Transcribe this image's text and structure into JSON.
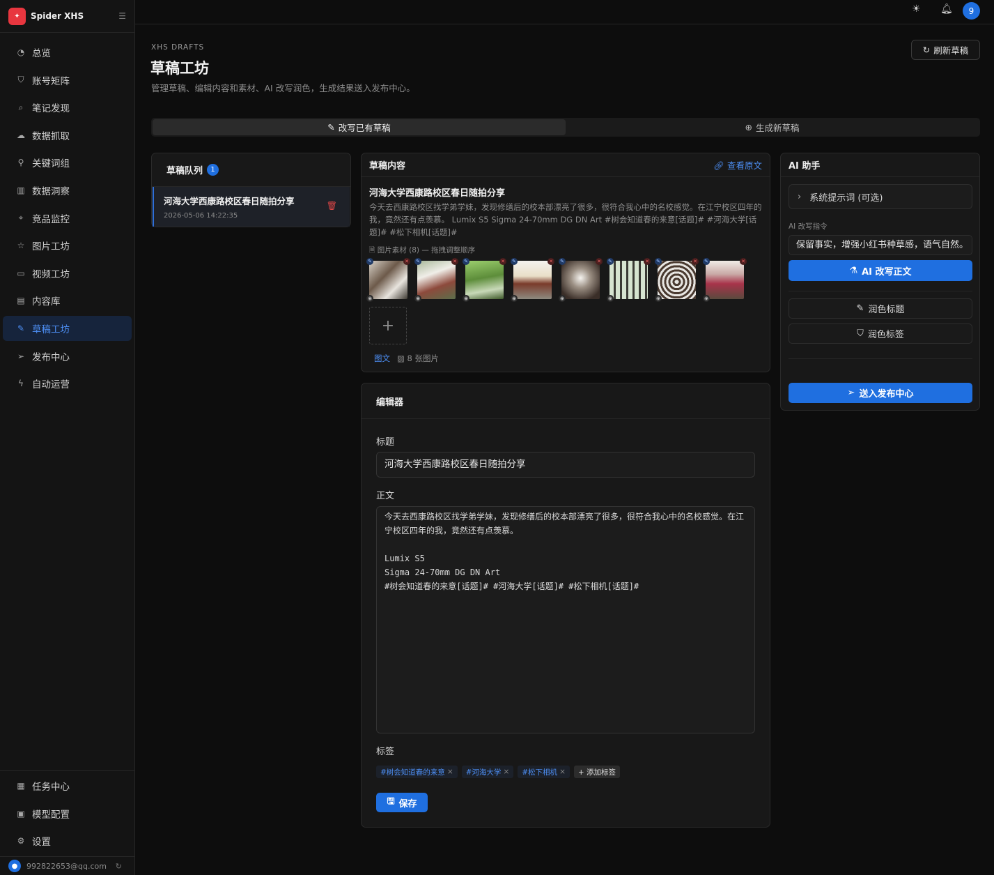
{
  "app": {
    "name": "Spider XHS"
  },
  "nav": {
    "items": [
      {
        "label": "总览",
        "icon": "gauge-icon"
      },
      {
        "label": "账号矩阵",
        "icon": "shield-icon"
      },
      {
        "label": "笔记发现",
        "icon": "search-icon"
      },
      {
        "label": "数据抓取",
        "icon": "cloud-download-icon"
      },
      {
        "label": "关键词组",
        "icon": "key-search-icon"
      },
      {
        "label": "数据洞察",
        "icon": "bar-chart-icon"
      },
      {
        "label": "竞品监控",
        "icon": "crosshair-icon"
      },
      {
        "label": "图片工坊",
        "icon": "star-icon"
      },
      {
        "label": "视频工坊",
        "icon": "video-icon"
      },
      {
        "label": "内容库",
        "icon": "database-icon"
      },
      {
        "label": "草稿工坊",
        "icon": "edit-icon",
        "active": true
      },
      {
        "label": "发布中心",
        "icon": "send-icon"
      },
      {
        "label": "自动运营",
        "icon": "bolt-icon"
      }
    ],
    "bottom": [
      {
        "label": "任务中心",
        "icon": "calendar-icon"
      },
      {
        "label": "模型配置",
        "icon": "model-icon"
      },
      {
        "label": "设置",
        "icon": "gear-icon"
      }
    ]
  },
  "user": {
    "email": "992822653@qq.com"
  },
  "topbar": {
    "notifications": "9"
  },
  "page": {
    "eyebrow": "XHS DRAFTS",
    "title": "草稿工坊",
    "subtitle": "管理草稿、编辑内容和素材、AI 改写润色，生成结果送入发布中心。",
    "refresh_label": "刷新草稿"
  },
  "tabs": [
    {
      "label": "改写已有草稿",
      "active": true
    },
    {
      "label": "生成新草稿",
      "active": false
    }
  ],
  "queue": {
    "title": "草稿队列",
    "count": "1",
    "items": [
      {
        "title": "河海大学西康路校区春日随拍分享",
        "date": "2026-05-06 14:22:35"
      }
    ]
  },
  "draft": {
    "header": "草稿内容",
    "view_original": "查看原文",
    "title": "河海大学西康路校区春日随拍分享",
    "body": "今天去西康路校区找学弟学妹，发现修缮后的校本部漂亮了很多，很符合我心中的名校感觉。在江宁校区四年的我，竟然还有点羡慕。 Lumix S5 Sigma 24-70mm DG DN Art #树会知道春的来意[话题]# #河海大学[话题]# #松下相机[话题]#",
    "images_label": "图片素材 (8) — 拖拽调整顺序",
    "type_label": "图文",
    "count_label": "8 张图片"
  },
  "editor": {
    "header": "编辑器",
    "title_label": "标题",
    "title_value": "河海大学西康路校区春日随拍分享",
    "body_label": "正文",
    "body_value": "今天去西康路校区找学弟学妹，发现修缮后的校本部漂亮了很多，很符合我心中的名校感觉。在江宁校区四年的我，竟然还有点羡慕。\n\nLumix S5\nSigma 24-70mm DG DN Art\n#树会知道春的来意[话题]# #河海大学[话题]# #松下相机[话题]#",
    "tags_label": "标签",
    "tags": [
      "#树会知道春的来意",
      "#河海大学",
      "#松下相机"
    ],
    "add_tag": "+ 添加标签",
    "save": "保存"
  },
  "ai": {
    "header": "AI 助手",
    "system_prompt": "系统提示词 (可选)",
    "instruction_label": "AI 改写指令",
    "instruction_value": "保留事实，增强小红书种草感，语气自然。",
    "rewrite": "AI 改写正文",
    "polish_title": "润色标题",
    "polish_tags": "润色标签",
    "send": "送入发布中心"
  },
  "colors": {
    "accent": "#1f6fe0",
    "danger": "#e04747",
    "background": "#0d0d0d"
  }
}
